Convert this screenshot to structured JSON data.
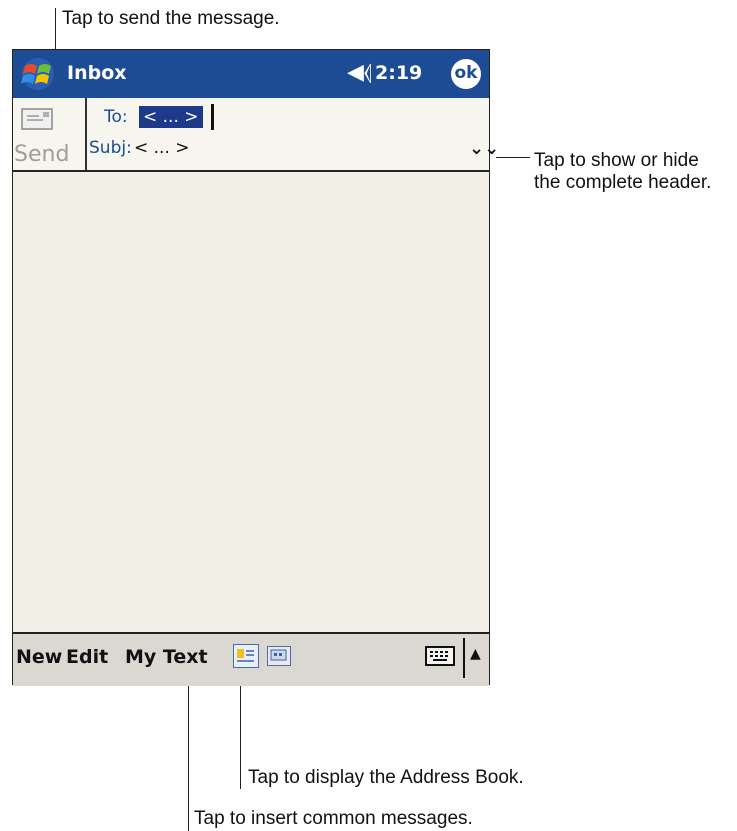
{
  "titlebar": {
    "title": "Inbox",
    "time": "2:19",
    "ok_label": "ok",
    "volume_icon": "speaker-icon",
    "start_icon": "windows-flag-icon"
  },
  "header": {
    "send_label": "Send",
    "to_label": "To:",
    "to_value": "< ... >",
    "subj_label": "Subj:",
    "subj_value": "< ... >",
    "expand_icon": "double-chevron-down-icon"
  },
  "menubar": {
    "new_label": "New",
    "edit_label": "Edit",
    "mytext_label": "My Text",
    "address_book_icon": "address-book-icon",
    "insert_icon": "insert-icon",
    "keyboard_icon": "keyboard-icon",
    "sip_arrow": "▲"
  },
  "callouts": {
    "send": "Tap to send the message.",
    "header_line1": "Tap to show or hide",
    "header_line2": "the complete header.",
    "address_book": "Tap to display the Address Book.",
    "insert": "Tap to insert common messages."
  },
  "colors": {
    "titlebar": "#1d4c95",
    "background": "#f2efe6",
    "menubar": "#dad8d0",
    "selection": "#1d3a8a"
  }
}
